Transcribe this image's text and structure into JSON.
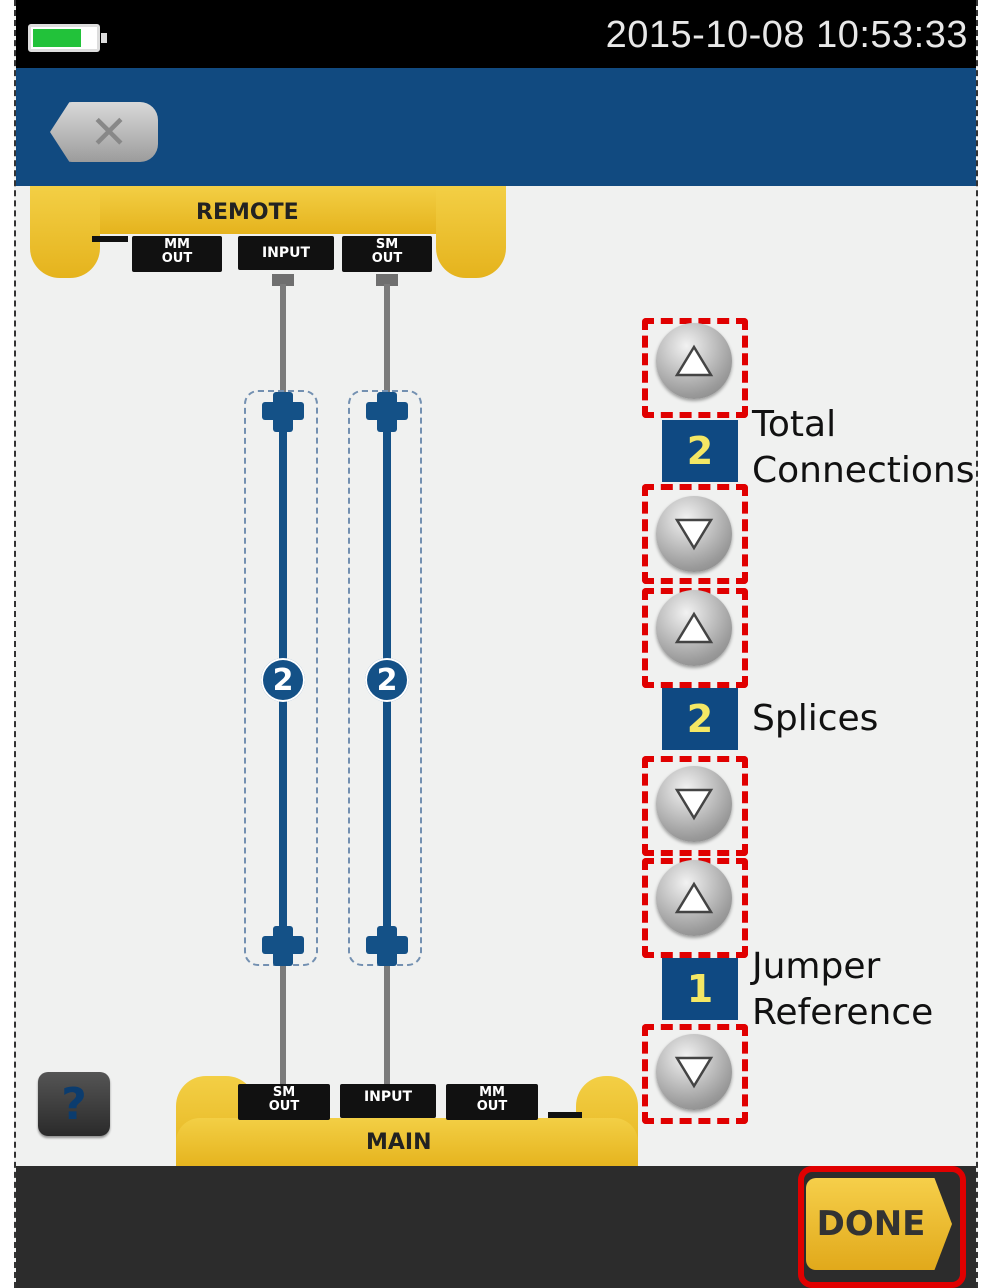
{
  "status_bar": {
    "datetime": "2015-10-08 10:53:33",
    "battery_icon": "battery-icon"
  },
  "title_bar": {
    "close_icon": "close-icon"
  },
  "remote_unit": {
    "label": "REMOTE",
    "ports": [
      {
        "line1": "MM",
        "line2": "OUT"
      },
      {
        "line1": "INPUT",
        "line2": ""
      },
      {
        "line1": "SM",
        "line2": "OUT"
      }
    ]
  },
  "main_unit": {
    "label": "MAIN",
    "ports": [
      {
        "line1": "SM",
        "line2": "OUT"
      },
      {
        "line1": "INPUT",
        "line2": ""
      },
      {
        "line1": "MM",
        "line2": "OUT"
      }
    ]
  },
  "diagram": {
    "splice_count_left": "2",
    "splice_count_right": "2"
  },
  "settings": [
    {
      "id": "total-connections",
      "value": "2",
      "label_line1": "Total",
      "label_line2": "Connections"
    },
    {
      "id": "splices",
      "value": "2",
      "label_line1": "Splices",
      "label_line2": ""
    },
    {
      "id": "jumper-reference",
      "value": "1",
      "label_line1": "Jumper",
      "label_line2": "Reference"
    }
  ],
  "help": {
    "glyph": "?"
  },
  "footer": {
    "done_label": "DONE"
  },
  "colors": {
    "brand_blue": "#114a80",
    "accent_yellow": "#e9b825",
    "highlight_red": "#e00000"
  }
}
